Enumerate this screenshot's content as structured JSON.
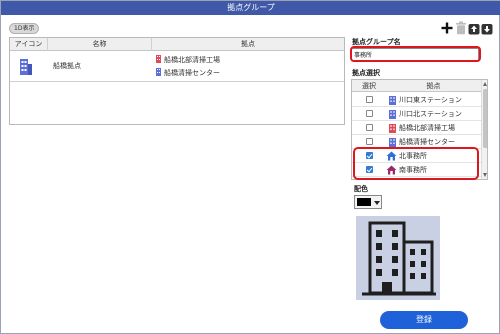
{
  "window": {
    "title": "拠点グループ"
  },
  "list": {
    "count_badge": "1D表示",
    "columns": [
      "アイコン",
      "名称",
      "拠点"
    ],
    "rows": [
      {
        "name": "船橋拠点",
        "bases": [
          "船橋北部清掃工場",
          "船橋清掃センター"
        ]
      }
    ]
  },
  "form": {
    "group_name_label": "拠点グループ名",
    "group_name_value": "事務所",
    "base_select_label": "拠点選択",
    "base_list_columns": [
      "選択",
      "拠点"
    ],
    "bases": [
      {
        "label": "川口東ステーション",
        "checked": false,
        "icon": "building-icon",
        "icon_color": "#5b6fd6"
      },
      {
        "label": "川口北ステーション",
        "checked": false,
        "icon": "building-icon",
        "icon_color": "#5b6fd6"
      },
      {
        "label": "船橋北部清掃工場",
        "checked": false,
        "icon": "building-icon",
        "icon_color": "#e04b5a"
      },
      {
        "label": "船橋清掃センター",
        "checked": false,
        "icon": "building-icon",
        "icon_color": "#5b6fd6"
      },
      {
        "label": "北事務所",
        "checked": true,
        "icon": "house-icon",
        "icon_color": "#2f6fd6"
      },
      {
        "label": "南事務所",
        "checked": true,
        "icon": "house-icon",
        "icon_color": "#9b2a6b"
      }
    ],
    "color_label": "配色",
    "color_value": "#000000",
    "register_label": "登録"
  },
  "colors": {
    "titlebar": "#3f58a8",
    "accent": "#1f61d8",
    "highlight": "#e0161d"
  },
  "toolbar_icons": [
    "add-icon",
    "delete-icon",
    "upload-icon",
    "download-icon"
  ]
}
